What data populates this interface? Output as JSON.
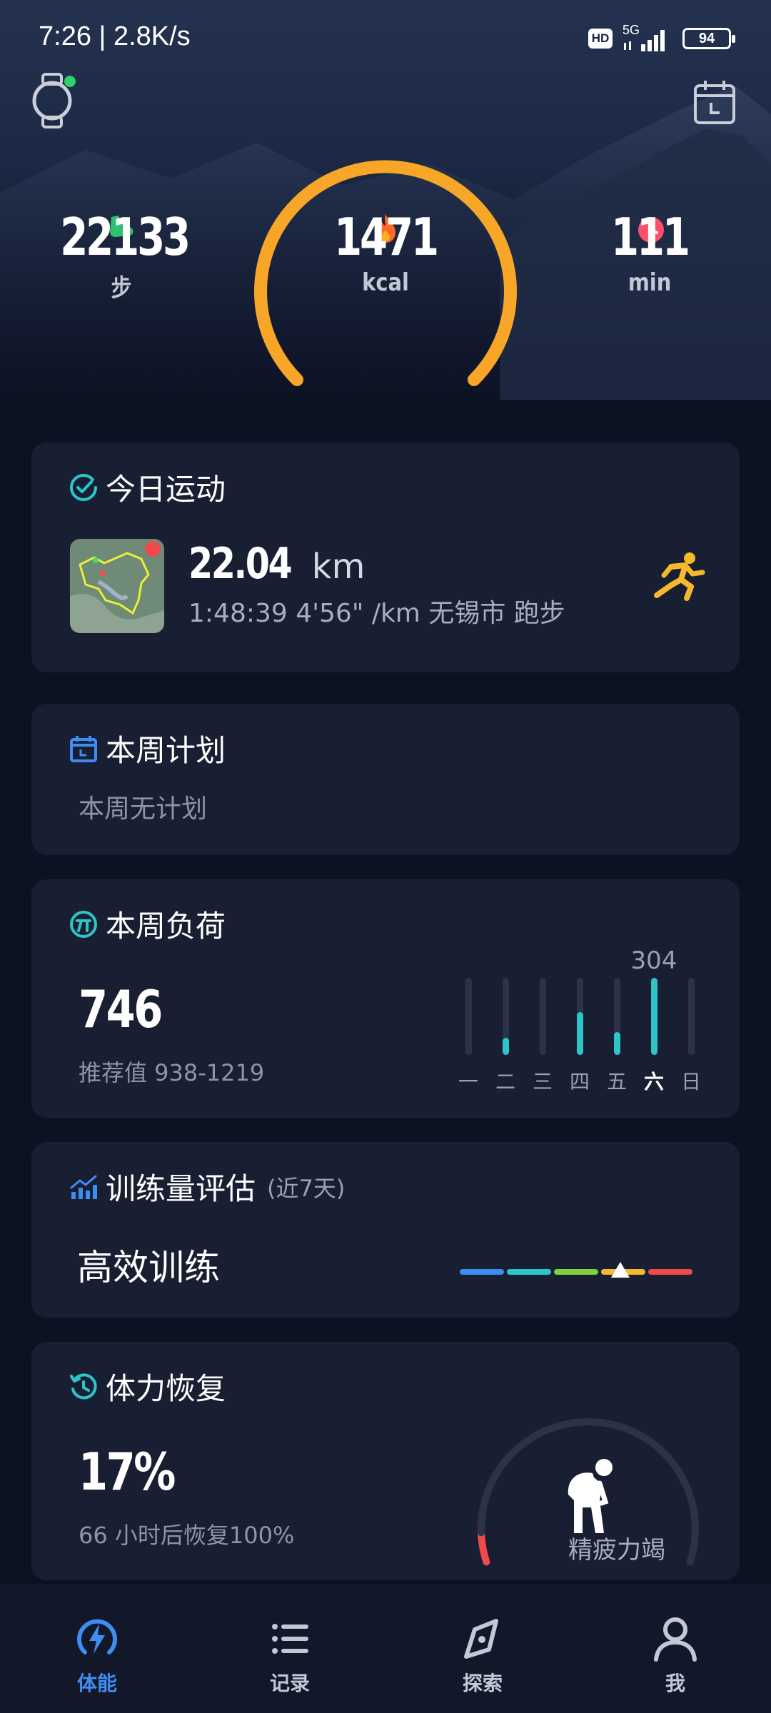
{
  "status_bar": {
    "time": "7:26 | 2.8K/s",
    "hd": "HD",
    "network": "5G",
    "battery": "94"
  },
  "header": {
    "watch_icon": "watch-icon",
    "calendar_icon": "calendar-icon"
  },
  "stats": {
    "steps": {
      "value": "22133",
      "unit": "步",
      "icon": "shoe-icon",
      "color": "#2fbf71"
    },
    "calories": {
      "value": "1471",
      "unit": "kcal",
      "icon": "flame-icon",
      "color": "#ff6a2b"
    },
    "minutes": {
      "value": "111",
      "unit": "min",
      "icon": "clock-icon",
      "color": "#ff4d6a"
    },
    "ring_color": "#ffb020",
    "ring_progress": 1.0
  },
  "today_activity": {
    "title": "今日运动",
    "distance_value": "22.04",
    "distance_unit": "km",
    "detail": "1:48:39 4'56\" /km  无锡市 跑步",
    "icon": "running-icon"
  },
  "weekly_plan": {
    "title": "本周计划",
    "empty_text": "本周无计划"
  },
  "weekly_load": {
    "title": "本周负荷",
    "value": "746",
    "recommendation": "推荐值 938-1219",
    "peak_label": "304",
    "days": [
      {
        "label": "一",
        "fraction": 0.0,
        "active": false
      },
      {
        "label": "二",
        "fraction": 0.22,
        "active": false
      },
      {
        "label": "三",
        "fraction": 0.0,
        "active": false
      },
      {
        "label": "四",
        "fraction": 0.56,
        "active": false
      },
      {
        "label": "五",
        "fraction": 0.3,
        "active": false
      },
      {
        "label": "六",
        "fraction": 1.0,
        "active": true
      },
      {
        "label": "日",
        "fraction": 0.0,
        "active": false
      }
    ],
    "bar_color": "#2cc6c9"
  },
  "training_assessment": {
    "title": "训练量评估",
    "subtitle": "(近7天)",
    "status": "高效训练",
    "scale_colors": [
      "#3e8df3",
      "#2cc6c9",
      "#7fd13b",
      "#f5b82e",
      "#ef4b4b"
    ],
    "marker_fraction": 0.69
  },
  "recovery": {
    "title": "体力恢复",
    "value": "17%",
    "note": "66 小时后恢复100%",
    "status": "精疲力竭",
    "level_fraction": 0.17,
    "gauge_color": "#ef4b4b"
  },
  "nav": {
    "items": [
      {
        "label": "体能",
        "icon": "bolt-icon",
        "active": true
      },
      {
        "label": "记录",
        "icon": "list-icon",
        "active": false
      },
      {
        "label": "探索",
        "icon": "compass-icon",
        "active": false
      },
      {
        "label": "我",
        "icon": "user-icon",
        "active": false
      }
    ]
  }
}
